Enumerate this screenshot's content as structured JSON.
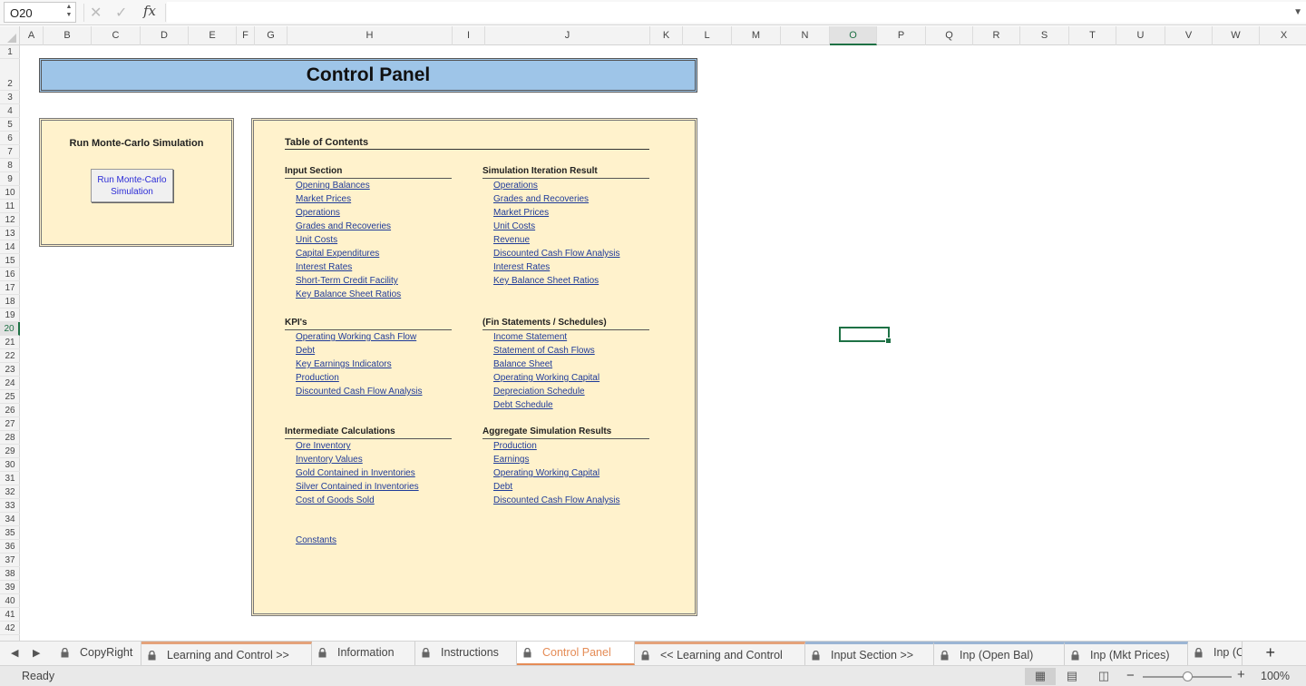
{
  "formula_bar": {
    "name_box": "O20",
    "cancel_icon": "✕",
    "confirm_icon": "✓",
    "fx_label": "fx",
    "formula": ""
  },
  "columns": [
    "A",
    "B",
    "C",
    "D",
    "E",
    "F",
    "G",
    "H",
    "I",
    "J",
    "K",
    "L",
    "M",
    "N",
    "O",
    "P",
    "Q",
    "R",
    "S",
    "T",
    "U",
    "V",
    "W",
    "X"
  ],
  "rows": [
    "1",
    "2",
    "3",
    "4",
    "5",
    "6",
    "7",
    "8",
    "9",
    "10",
    "11",
    "12",
    "13",
    "14",
    "15",
    "16",
    "17",
    "18",
    "19",
    "20",
    "21",
    "22",
    "23",
    "24",
    "25",
    "26",
    "27",
    "28",
    "29",
    "30",
    "31",
    "32",
    "33",
    "34",
    "35",
    "36",
    "37",
    "38",
    "39",
    "40",
    "41",
    "42"
  ],
  "selected": {
    "column": "O",
    "row": "20"
  },
  "sheet": {
    "title": "Control Panel",
    "monte_carlo": {
      "heading": "Run Monte-Carlo Simulation",
      "button_line1": "Run Monte-Carlo",
      "button_line2": "Simulation"
    },
    "toc": {
      "title": "Table of Contents",
      "input_section": {
        "heading": "Input Section",
        "links": [
          "Opening  Balances",
          "Market Prices",
          "Operations",
          "Grades and Recoveries",
          "Unit Costs",
          "Capital Expenditures",
          "Interest Rates",
          "Short-Term Credit Facility",
          "Key Balance Sheet Ratios"
        ]
      },
      "simulation_iteration": {
        "heading": "Simulation Iteration Result",
        "links": [
          "Operations",
          "Grades and Recoveries",
          "Market Prices",
          "Unit Costs",
          "Revenue",
          "Discounted Cash Flow Analysis",
          "Interest Rates",
          "Key Balance Sheet Ratios"
        ]
      },
      "kpis": {
        "heading": "KPI's",
        "links": [
          "Operating Working Cash Flow",
          "Debt",
          "Key Earnings Indicators",
          "Production",
          "Discounted Cash Flow Analysis"
        ]
      },
      "fin_statements": {
        "heading": "(Fin Statements / Schedules)",
        "links": [
          "Income Statement",
          "Statement of Cash Flows",
          "Balance Sheet",
          "Operating Working Capital",
          "Depreciation Schedule",
          "Debt Schedule"
        ]
      },
      "intermediate": {
        "heading": "Intermediate Calculations",
        "links": [
          "Ore Inventory",
          "Inventory Values",
          "Gold Contained in Inventories",
          "Silver Contained in Inventories",
          "Cost of Goods Sold"
        ]
      },
      "aggregate": {
        "heading": "Aggregate Simulation Results",
        "links": [
          "Production",
          "Earnings",
          "Operating Working Capital",
          "Debt",
          "Discounted Cash Flow Analysis"
        ]
      },
      "constants_link": "Constants"
    }
  },
  "tabs": [
    "CopyRight",
    "Learning and Control >>",
    "Information",
    "Instructions",
    "Control Panel",
    "<< Learning and Control",
    "Input Section >>",
    "Inp (Open Bal)",
    "Inp (Mkt Prices)",
    "Inp (O"
  ],
  "active_tab": "Control Panel",
  "status": {
    "text": "Ready",
    "zoom": "100%",
    "zoom_level_percent": 100
  }
}
